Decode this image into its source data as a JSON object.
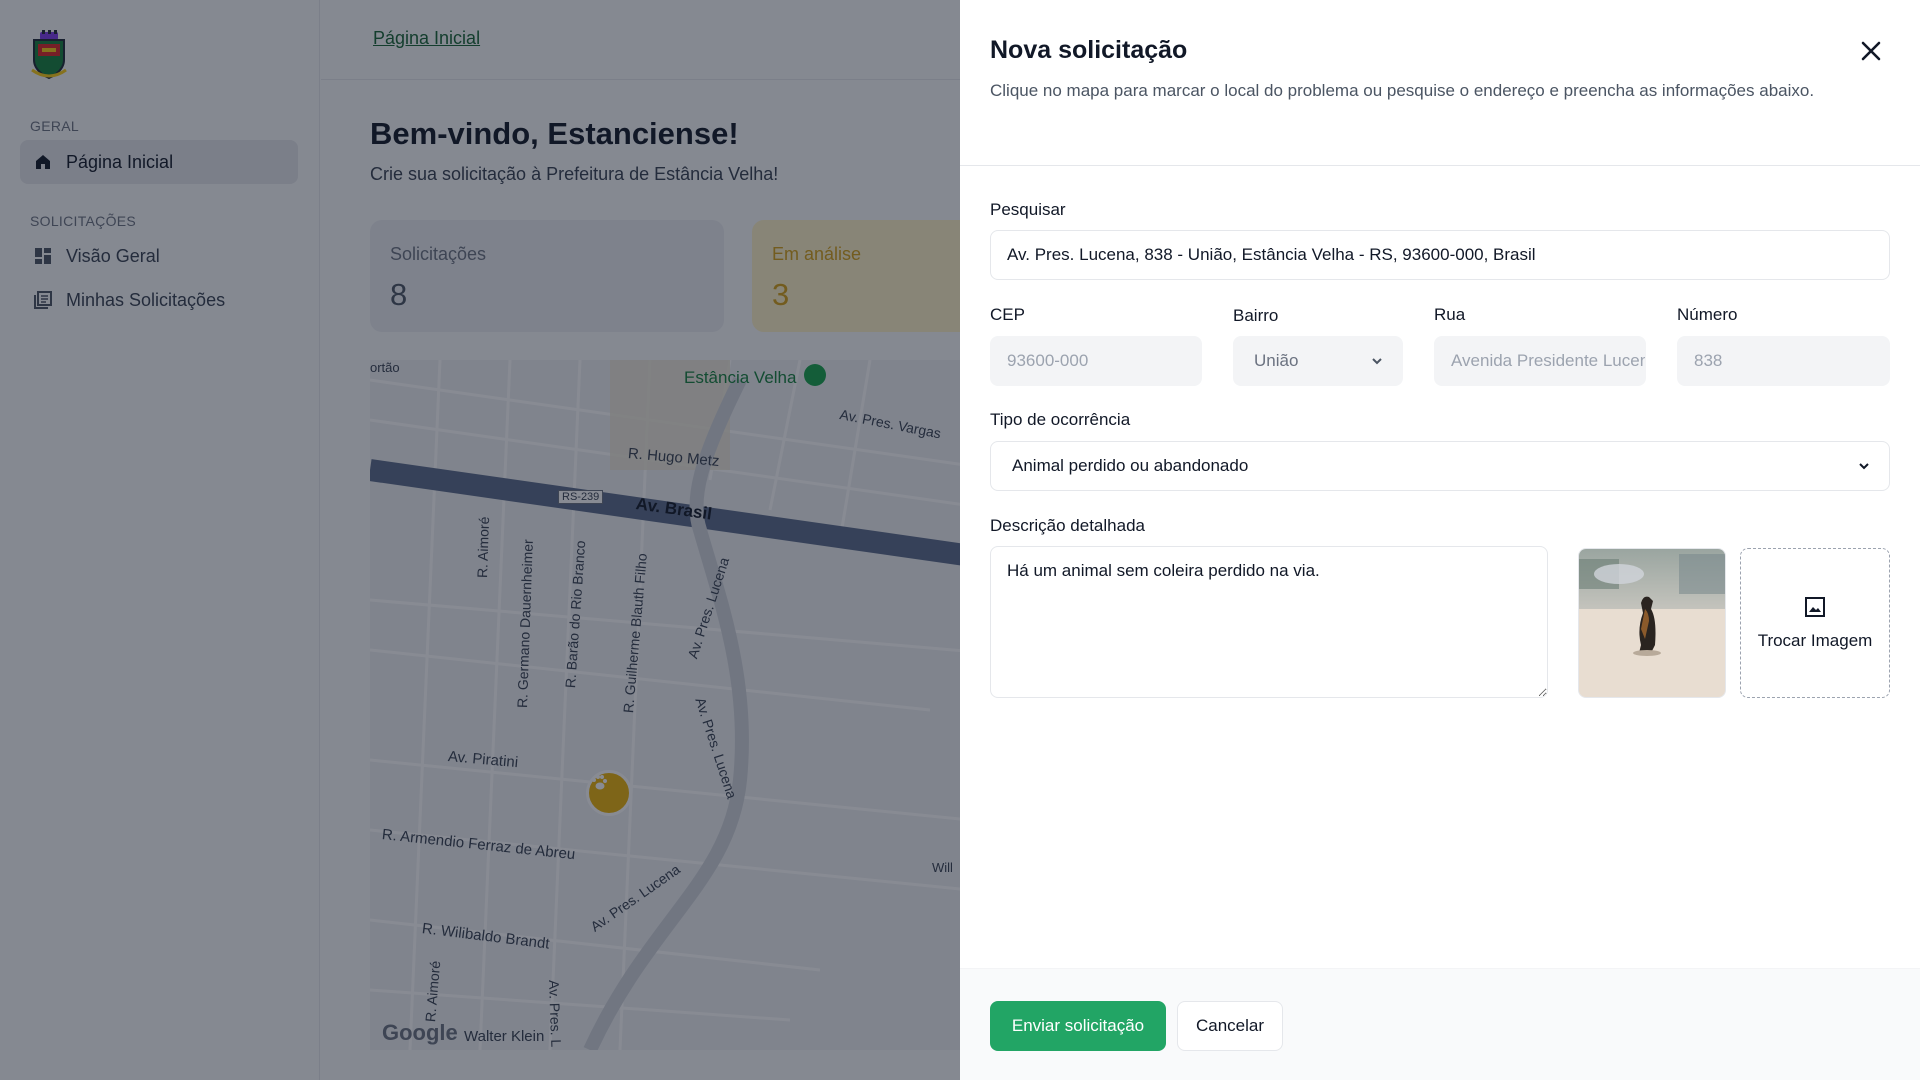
{
  "breadcrumb": {
    "home": "Página Inicial"
  },
  "sidebar": {
    "groups": [
      {
        "label": "GERAL"
      },
      {
        "label": "SOLICITAÇÕES"
      }
    ],
    "items": [
      {
        "label": "Página Inicial",
        "icon": "home-icon",
        "active": true
      },
      {
        "label": "Visão Geral",
        "icon": "grid-icon"
      },
      {
        "label": "Minhas Solicitações",
        "icon": "list-icon"
      }
    ]
  },
  "welcome": {
    "title": "Bem-vindo, Estanciense!",
    "subtitle": "Crie sua solicitação à Prefeitura de Estância Velha!"
  },
  "stats": [
    {
      "label": "Solicitações",
      "value": "8"
    },
    {
      "label": "Em análise",
      "value": "3"
    }
  ],
  "map": {
    "labels": {
      "portao": "ortão",
      "estancia_velha": "Estância Velha",
      "av_pres_vargas": "Av. Pres. Vargas",
      "r_hugo_metz": "R. Hugo Metz",
      "rs_239": "RS-239",
      "av_brasil": "Av. Brasil",
      "r_aimore": "R. Aimoré",
      "r_germano": "R. Germano Dauernheimer",
      "r_barao": "R. Barão do Rio Branco",
      "r_guilherme": "R. Guilherme Blauth Filho",
      "av_pres_lucena_1": "Av. Pres. Lucena",
      "av_pres_lucena_2": "Av. Pres. Lucena",
      "av_piratini": "Av. Piratini",
      "r_armendio": "R. Armendio Ferraz de Abreu",
      "av_pres_lucena_3": "Av. Pres. Lucena",
      "r_wilibaldo": "R. Wilibaldo Brandt",
      "r_aimore_2": "R. Aimoré",
      "av_pres_l": "Av. Pres. L",
      "walter_klein": "Walter Klein",
      "will": "Will",
      "google": "Google"
    },
    "marker_icon": "paw-icon"
  },
  "modal": {
    "title": "Nova solicitação",
    "description": "Clique no mapa para marcar o local do problema ou pesquise o endereço e preencha as informações abaixo.",
    "fields": {
      "search": {
        "label": "Pesquisar",
        "value": "Av. Pres. Lucena, 838 - União, Estância Velha - RS, 93600-000, Brasil"
      },
      "cep": {
        "label": "CEP",
        "value": "93600-000"
      },
      "bairro": {
        "label": "Bairro",
        "value": "União"
      },
      "rua": {
        "label": "Rua",
        "value": "Avenida Presidente Lucena"
      },
      "numero": {
        "label": "Número",
        "value": "838"
      },
      "tipo": {
        "label": "Tipo de ocorrência",
        "value": "Animal perdido ou abandonado"
      },
      "descricao": {
        "label": "Descrição detalhada",
        "value": "Há um animal sem coleira perdido na via."
      }
    },
    "swap_image_label": "Trocar Imagem",
    "submit_label": "Enviar solicitação",
    "cancel_label": "Cancelar"
  },
  "colors": {
    "primary": "#22a565",
    "link": "#166534",
    "warning": "#d4a017",
    "marker": "#eab308"
  }
}
